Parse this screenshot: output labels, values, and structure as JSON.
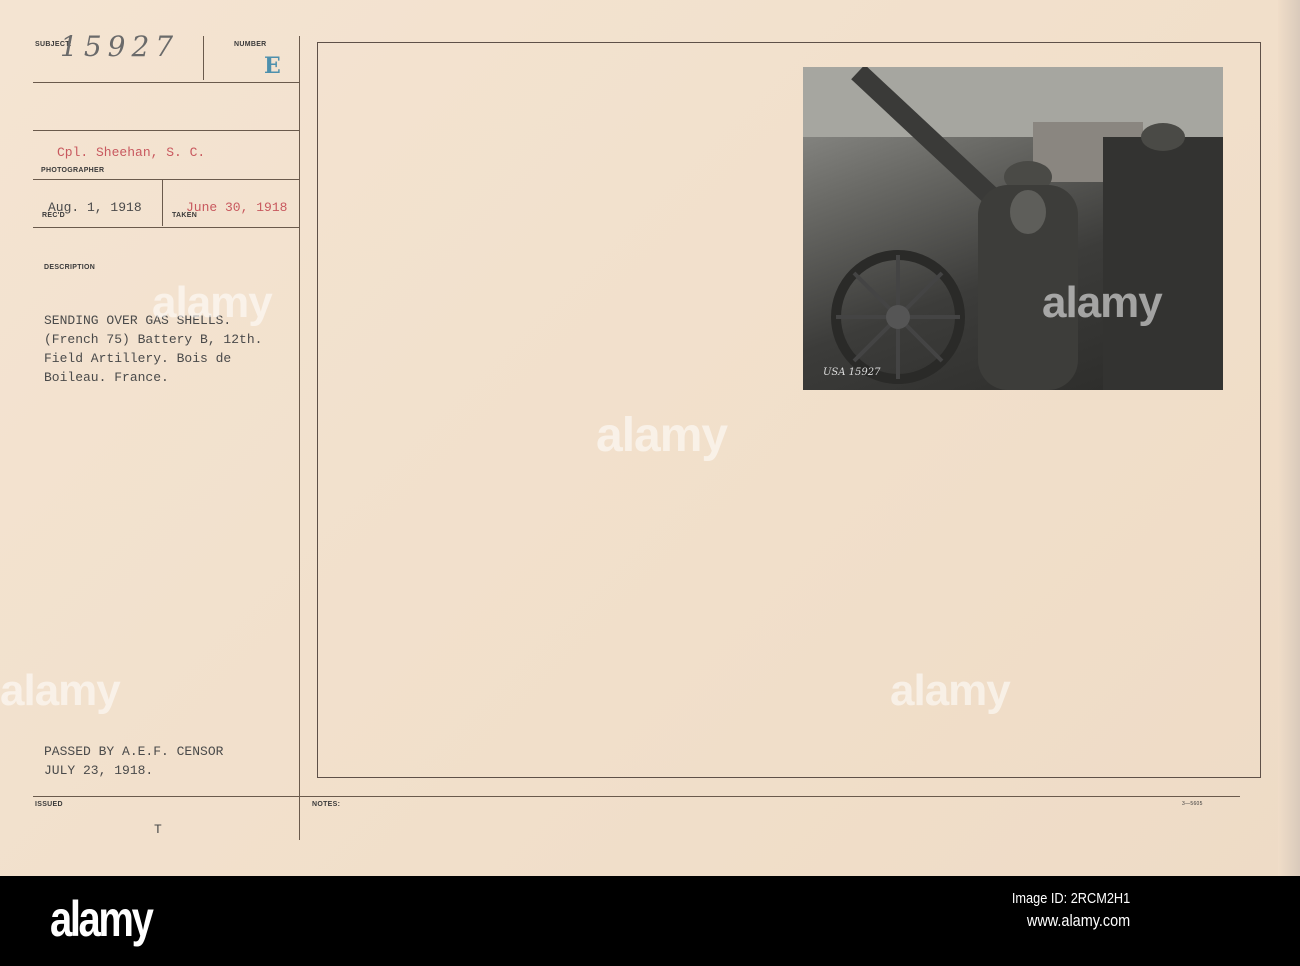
{
  "card": {
    "labels": {
      "subject": "SUBJECT:",
      "number": "NUMBER",
      "photographer": "PHOTOGRAPHER",
      "recd": "REC'D",
      "taken": "TAKEN",
      "description": "DESCRIPTION",
      "issued": "ISSUED",
      "notes": "NOTES:"
    },
    "subject_number": "15927",
    "number_stamp": "E",
    "photographer": "Cpl. Sheehan, S. C.",
    "received_date": "Aug. 1, 1918",
    "taken_date": "June 30, 1918",
    "description": [
      "SENDING OVER GAS SHELLS.",
      "(French 75) Battery B, 12th.",
      "Field Artillery. Bois de",
      "Boileau. France."
    ],
    "censor": [
      "PASSED BY A.E.F. CENSOR",
      "JULY 23, 1918."
    ],
    "issued_mark": "T",
    "form_code": "3—5605",
    "photo_caption": "USA 15927"
  },
  "watermark": "alamy",
  "footer": {
    "logo": "alamy",
    "image_id": "Image ID: 2RCM2H1",
    "url": "www.alamy.com"
  }
}
